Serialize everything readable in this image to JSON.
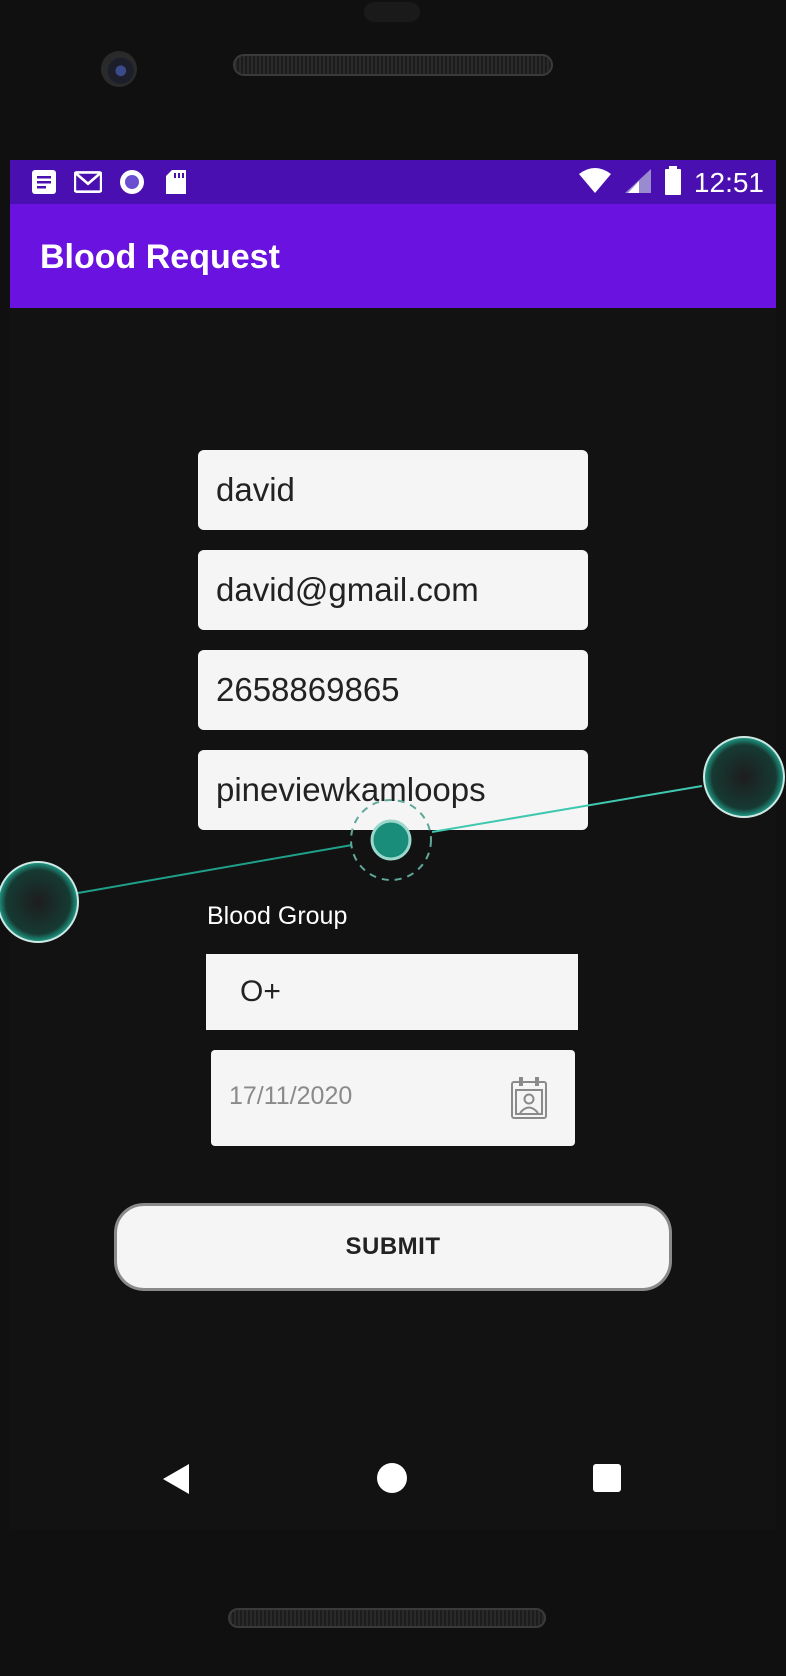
{
  "status_bar": {
    "time": "12:51",
    "icons": [
      "notes-icon",
      "gmail-icon",
      "record-icon",
      "sd-card-icon",
      "wifi-icon",
      "signal-icon",
      "battery-icon"
    ]
  },
  "app_bar": {
    "title": "Blood Request"
  },
  "form": {
    "name_value": "david",
    "email_value": "david@gmail.com",
    "phone_value": "2658869865",
    "address_value": "pineviewkamloops",
    "blood_group_label": "Blood Group",
    "blood_group_value": "O+",
    "date_value": "17/11/2020",
    "submit_label": "SUBMIT"
  },
  "colors": {
    "status_bar": "#4a0fb0",
    "app_bar": "#6a12e0",
    "touch_indicator": "#1fa08a"
  }
}
